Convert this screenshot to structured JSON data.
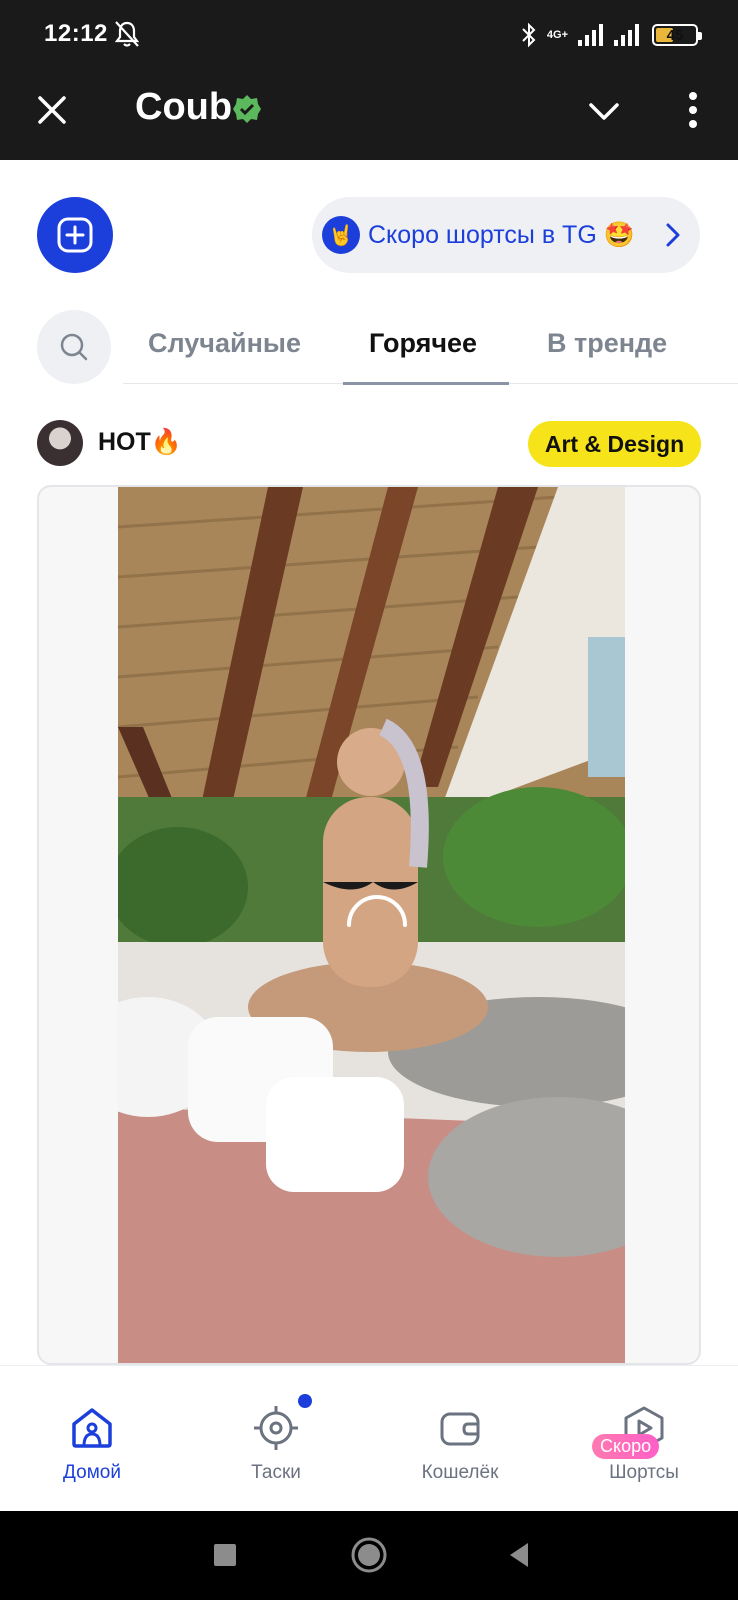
{
  "status_bar": {
    "time": "12:12",
    "network": "4G+",
    "battery": "45",
    "battery_level": 0.45,
    "icons": [
      "mute-icon",
      "bluetooth-icon",
      "signal-icon",
      "battery-icon"
    ]
  },
  "header": {
    "title": "Coub",
    "icons": [
      "close-icon",
      "verified-icon",
      "chevron-down-icon",
      "more-vertical-icon"
    ]
  },
  "promo": {
    "text": "Скоро шортсы в TG 🤩",
    "icon": "rock-hand-icon"
  },
  "tabs": [
    {
      "label": "Случайные"
    },
    {
      "label": "Горячее",
      "active": true
    },
    {
      "label": "В тренде"
    }
  ],
  "post": {
    "channel": "HOT🔥",
    "tag": "Art & Design"
  },
  "bottom_nav": [
    {
      "label": "Домой",
      "icon": "home-icon",
      "active": true
    },
    {
      "label": "Таски",
      "icon": "target-icon"
    },
    {
      "label": "Кошелёк",
      "icon": "wallet-icon"
    },
    {
      "label": "Шортсы",
      "icon": "shorts-play-icon",
      "badge": "Скоро"
    }
  ],
  "colors": {
    "accent": "#1c3fdc",
    "header_bg": "#1a1a1a",
    "tag_bg": "#f6e31a",
    "verified": "#5cb85c"
  }
}
